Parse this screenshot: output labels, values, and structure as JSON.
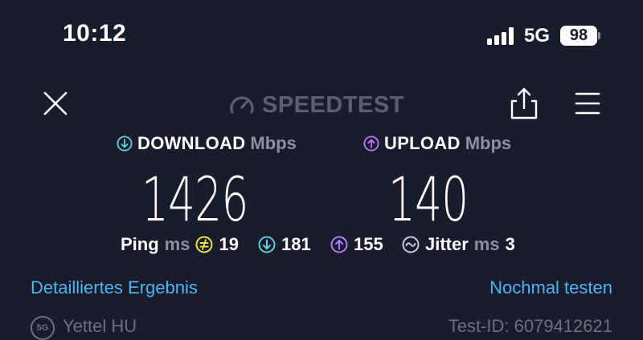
{
  "status": {
    "time": "10:12",
    "network": "5G",
    "battery": "98"
  },
  "header": {
    "logo_text": "SPEEDTEST"
  },
  "download": {
    "label": "DOWNLOAD",
    "unit": "Mbps",
    "value": "1426",
    "icon": "arrow-down-circle-icon",
    "color": "#5fd0d8"
  },
  "upload": {
    "label": "UPLOAD",
    "unit": "Mbps",
    "value": "140",
    "icon": "arrow-up-circle-icon",
    "color": "#b07cff"
  },
  "ping": {
    "label": "Ping",
    "unit": "ms",
    "idle": "19",
    "download": "181",
    "upload": "155",
    "idle_color": "#f0e14a"
  },
  "jitter": {
    "label": "Jitter",
    "unit": "ms",
    "value": "3"
  },
  "actions": {
    "details": "Detailliertes Ergebnis",
    "retest": "Nochmal testen"
  },
  "footer": {
    "badge": "5G",
    "provider": "Yettel HU",
    "test_id": "Test-ID: 6079412621"
  }
}
